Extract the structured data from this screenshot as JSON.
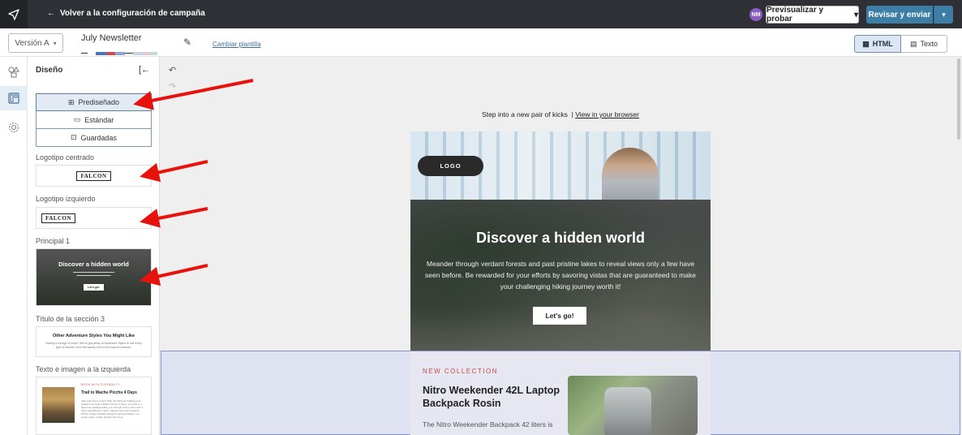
{
  "topbar": {
    "back_label": "Volver a la configuración de campaña",
    "avatar_initials": "NM",
    "preview_label": "Previsualizar y probar",
    "review_label": "Revisar y enviar"
  },
  "subbar": {
    "version_label": "Versión A",
    "newsletter_name": "July Newsletter",
    "change_template_label": "Cambiar plantilla",
    "html_label": "HTML",
    "text_label": "Texto"
  },
  "panel": {
    "title": "Diseño",
    "tabs": [
      {
        "label": "Prediseñado"
      },
      {
        "label": "Estándar"
      },
      {
        "label": "Guardadas"
      }
    ],
    "sections": [
      {
        "label": "Logotipo centrado",
        "logo_text": "FALCON"
      },
      {
        "label": "Logotipo izquierdo",
        "logo_text": "FALCON"
      },
      {
        "label": "Principal 1",
        "thumb_title": "Discover a hidden world",
        "thumb_button": "Let's go!"
      },
      {
        "label": "Título de la sección 3",
        "thumb_title": "Other Adventure Styles You Might Like",
        "thumb_body": "Having a change of heart? We've got plenty of Adventure Styles to suit every type of traveler, from the bakery buff to the tropical romance."
      },
      {
        "label": "Texto e imagen a la izquierda",
        "thumb_kicker": "BOOK WITH FLEXIBILITY",
        "thumb_title": "Trail to Machu Picchu 4 Days",
        "thumb_body": "Start and end in Cusco! With the Hiking & Trekking tour Classic Inca Trail to Machu Picchu 4 Days, you have a 4 days tour package taking you through Cusco, Peru and 4 other destinations in Peru. Classic Inca Trail to Machu Picchu 4 Days includes transport, accommodation, an expert guide, meals, transfer and more."
      }
    ]
  },
  "email": {
    "preheader_text": "Step into a new pair of kicks",
    "preheader_link": "View in your browser",
    "logo_label": "LOGO",
    "hero_title": "Discover a hidden world",
    "hero_body": "Meander through verdant forests and past pristine lakes to reveal views only a few have seen before. Be rewarded for your efforts by savoring vistas that are guaranteed to make your challenging hiking journey worth it!",
    "hero_button": "Let's go!",
    "product_kicker": "NEW COLLECTION",
    "product_title": "Nitro Weekender 42L Laptop Backpack Rosin",
    "product_body": "The Nitro Weekender Backpack 42 liters is"
  },
  "colors": {
    "topbar": "#2f3035",
    "accent": "#3d7ea6",
    "annotation_arrow": "#e8120c",
    "selection": "#8a93d0"
  }
}
